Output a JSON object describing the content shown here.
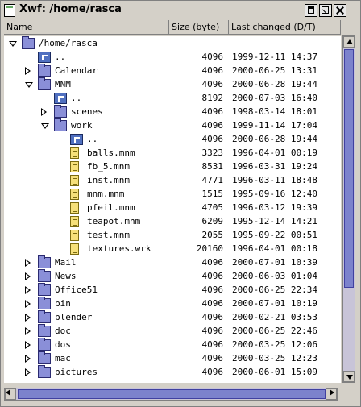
{
  "window": {
    "title": "Xwf: /home/rasca"
  },
  "columns": {
    "name": "Name",
    "size": "Size (byte)",
    "date": "Last changed (D/T)"
  },
  "rows": [
    {
      "type": "folder",
      "depth": 0,
      "expander": "open",
      "name": "/home/rasca",
      "size": "",
      "date": ""
    },
    {
      "type": "updir",
      "depth": 1,
      "expander": "none",
      "name": "..",
      "size": "4096",
      "date": "1999-12-11 14:37"
    },
    {
      "type": "folder",
      "depth": 1,
      "expander": "closed",
      "name": "Calendar",
      "size": "4096",
      "date": "2000-06-25 13:31"
    },
    {
      "type": "folder",
      "depth": 1,
      "expander": "open",
      "name": "MNM",
      "size": "4096",
      "date": "2000-06-28 19:44"
    },
    {
      "type": "updir",
      "depth": 2,
      "expander": "none",
      "name": "..",
      "size": "8192",
      "date": "2000-07-03 16:40"
    },
    {
      "type": "folder",
      "depth": 2,
      "expander": "closed",
      "name": "scenes",
      "size": "4096",
      "date": "1998-03-14 18:01"
    },
    {
      "type": "folder",
      "depth": 2,
      "expander": "open",
      "name": "work",
      "size": "4096",
      "date": "1999-11-14 17:04"
    },
    {
      "type": "updir",
      "depth": 3,
      "expander": "none",
      "name": "..",
      "size": "4096",
      "date": "2000-06-28 19:44"
    },
    {
      "type": "file",
      "depth": 3,
      "expander": "none",
      "name": "balls.mnm",
      "size": "3323",
      "date": "1996-04-01 00:19"
    },
    {
      "type": "file",
      "depth": 3,
      "expander": "none",
      "name": "fb_5.mnm",
      "size": "8531",
      "date": "1996-03-31 19:24"
    },
    {
      "type": "file",
      "depth": 3,
      "expander": "none",
      "name": "inst.mnm",
      "size": "4771",
      "date": "1996-03-11 18:48"
    },
    {
      "type": "file",
      "depth": 3,
      "expander": "none",
      "name": "mnm.mnm",
      "size": "1515",
      "date": "1995-09-16 12:40"
    },
    {
      "type": "file",
      "depth": 3,
      "expander": "none",
      "name": "pfeil.mnm",
      "size": "4705",
      "date": "1996-03-12 19:39"
    },
    {
      "type": "file",
      "depth": 3,
      "expander": "none",
      "name": "teapot.mnm",
      "size": "6209",
      "date": "1995-12-14 14:21"
    },
    {
      "type": "file",
      "depth": 3,
      "expander": "none",
      "name": "test.mnm",
      "size": "2055",
      "date": "1995-09-22 00:51"
    },
    {
      "type": "file",
      "depth": 3,
      "expander": "none",
      "name": "textures.wrk",
      "size": "20160",
      "date": "1996-04-01 00:18"
    },
    {
      "type": "folder",
      "depth": 1,
      "expander": "closed",
      "name": "Mail",
      "size": "4096",
      "date": "2000-07-01 10:39"
    },
    {
      "type": "folder",
      "depth": 1,
      "expander": "closed",
      "name": "News",
      "size": "4096",
      "date": "2000-06-03 01:04"
    },
    {
      "type": "folder",
      "depth": 1,
      "expander": "closed",
      "name": "Office51",
      "size": "4096",
      "date": "2000-06-25 22:34"
    },
    {
      "type": "folder",
      "depth": 1,
      "expander": "closed",
      "name": "bin",
      "size": "4096",
      "date": "2000-07-01 10:19"
    },
    {
      "type": "folder",
      "depth": 1,
      "expander": "closed",
      "name": "blender",
      "size": "4096",
      "date": "2000-02-21 03:53"
    },
    {
      "type": "folder",
      "depth": 1,
      "expander": "closed",
      "name": "doc",
      "size": "4096",
      "date": "2000-06-25 22:46"
    },
    {
      "type": "folder",
      "depth": 1,
      "expander": "closed",
      "name": "dos",
      "size": "4096",
      "date": "2000-03-25 12:06"
    },
    {
      "type": "folder",
      "depth": 1,
      "expander": "closed",
      "name": "mac",
      "size": "4096",
      "date": "2000-03-25 12:23"
    },
    {
      "type": "folder",
      "depth": 1,
      "expander": "closed",
      "name": "pictures",
      "size": "4096",
      "date": "2000-06-01 15:09"
    }
  ],
  "scrollbars": {
    "vertical_position": 0.0,
    "vertical_visible_fraction": 0.72,
    "horizontal_visible_fraction": 0.95
  },
  "colors": {
    "folder": "#8a8fd8",
    "updir": "#5070c0",
    "file": "#f6e07a",
    "scroll_thumb": "#7c82cc",
    "scroll_track": "#c8c4d8"
  }
}
